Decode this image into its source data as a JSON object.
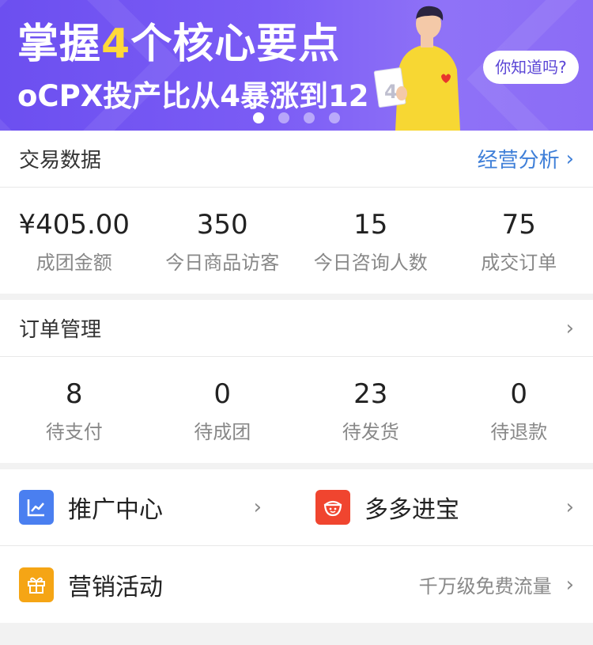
{
  "banner": {
    "headline_pre": "掌握",
    "headline_num": "4",
    "headline_post": "个核心要点",
    "subline": "oCPX投产比从4暴涨到12",
    "bubble": "你知道吗?",
    "paper_num": "4",
    "slides": 4,
    "active_slide": 1
  },
  "trade": {
    "title": "交易数据",
    "link": "经营分析",
    "stats": [
      {
        "value": "¥405.00",
        "label": "成团金额"
      },
      {
        "value": "350",
        "label": "今日商品访客"
      },
      {
        "value": "15",
        "label": "今日咨询人数"
      },
      {
        "value": "75",
        "label": "成交订单"
      }
    ]
  },
  "orders": {
    "title": "订单管理",
    "stats": [
      {
        "value": "8",
        "label": "待支付"
      },
      {
        "value": "0",
        "label": "待成团"
      },
      {
        "value": "23",
        "label": "待发货"
      },
      {
        "value": "0",
        "label": "待退款"
      }
    ]
  },
  "menu": {
    "promo": {
      "label": "推广中心",
      "icon": "chart-icon",
      "color": "#4a7ff0"
    },
    "duoduo": {
      "label": "多多进宝",
      "icon": "treasure-icon",
      "color": "#f0452f"
    },
    "marketing": {
      "label": "营销活动",
      "icon": "gift-icon",
      "color": "#f5a515",
      "hint": "千万级免费流量"
    }
  },
  "colors": {
    "banner_start": "#6c4ff0",
    "banner_end": "#8b6cf6",
    "highlight": "#ffd93a",
    "link": "#3f7fd8"
  }
}
